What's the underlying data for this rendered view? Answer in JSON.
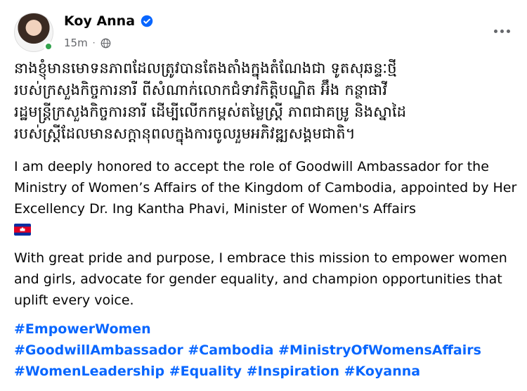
{
  "post": {
    "author_name": "Koy Anna",
    "timestamp": "15m",
    "meta_separator": "·",
    "khmer_text": "នាងខ្ញុំមានមោទនភាពដែលត្រូវបានតែងតាំងក្នុងតំណែងជា ទូតសុឆន្ទៈថ្មី\nរបស់ក្រសួងកិច្ចការនារី ពីសំណាក់លោកជំទាវកិត្តិបណ្ឌិត អ៊ឹង កន្ថាផាវី\nរដ្ឋមន្ត្រីក្រសួងកិច្ចការនារី ដើម្បីលើកកម្ពស់តម្លៃស្ត្រី ភាពជាគម្រូ និងស្នាដៃ\nរបស់ស្ត្រីដែលមានសក្តានុពលក្នុងការចូលរួមអភិវឌ្ឍសង្គមជាតិ។",
    "english_para_1": "I am deeply honored to accept the role of Goodwill Ambassador for the Ministry of Women’s Affairs of the Kingdom of Cambodia, appointed by Her Excellency Dr. Ing Kantha Phavi, Minister of Women's Affairs",
    "english_para_2": "With great pride and purpose, I embrace this mission to empower women and girls, advocate for gender equality, and champion opportunities that uplift every voice.",
    "hashtags_line_1": [
      "#EmpowerWomen"
    ],
    "hashtags_line_2": [
      "#GoodwillAmbassador",
      "#Cambodia",
      "#MinistryOfWomensAffairs"
    ],
    "hashtags_line_3": [
      "#WomenLeadership",
      "#Equality",
      "#Inspiration",
      "#Koyanna"
    ]
  },
  "icons": {
    "verified": "verified-badge-icon",
    "privacy": "globe-icon",
    "flag": "cambodia-flag-icon",
    "more": "more-options-icon"
  },
  "colors": {
    "text": "#050505",
    "secondary_text": "#65676b",
    "link": "#0866ff",
    "online": "#31a24c",
    "verified_badge": "#0866ff"
  }
}
